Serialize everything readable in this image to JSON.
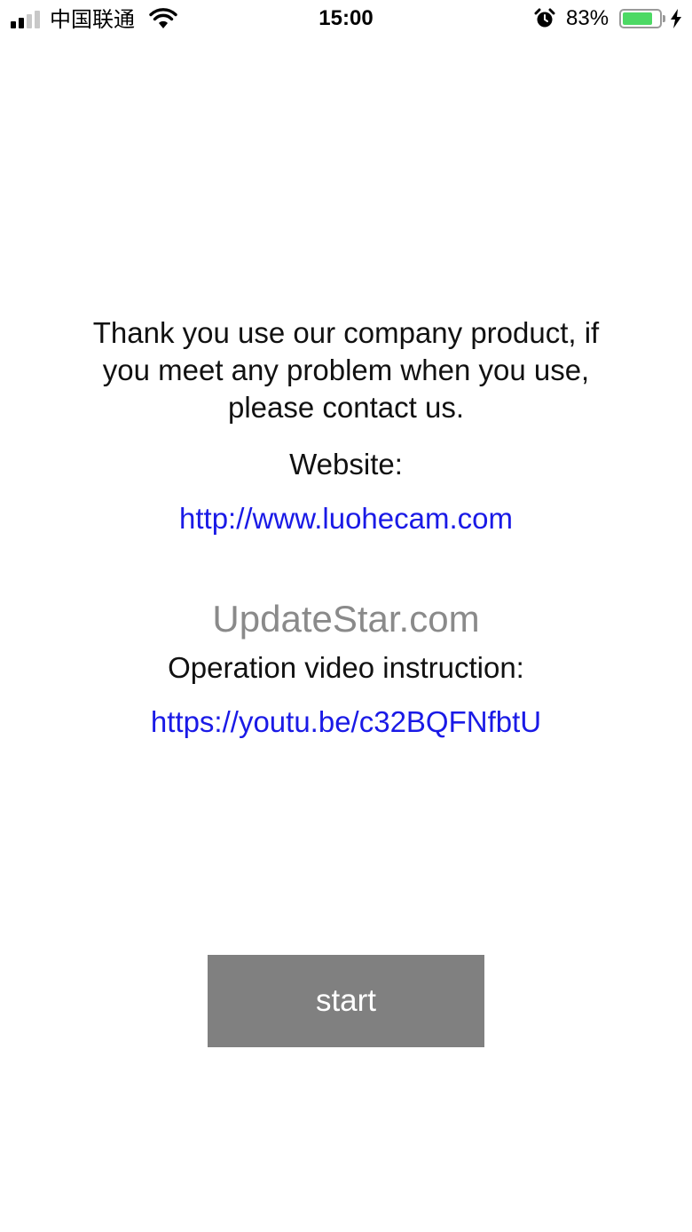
{
  "status_bar": {
    "carrier": "中国联通",
    "time": "15:00",
    "battery_percent": "83%",
    "battery_level": 0.83,
    "icons": [
      "signal-icon",
      "wifi-icon",
      "alarm-icon",
      "battery-icon",
      "charging-icon"
    ]
  },
  "main": {
    "message": "Thank you use our company product, if you meet any problem when you use, please contact us.",
    "website_label": "Website:",
    "website_url": "http://www.luohecam.com",
    "watermark": "UpdateStar.com",
    "video_label": "Operation video instruction:",
    "video_url": "https://youtu.be/c32BQFNfbtU",
    "start_label": "start"
  },
  "colors": {
    "link": "#1a1ae6",
    "button_bg": "#808080",
    "button_text": "#ffffff",
    "battery": "#4cd964"
  }
}
